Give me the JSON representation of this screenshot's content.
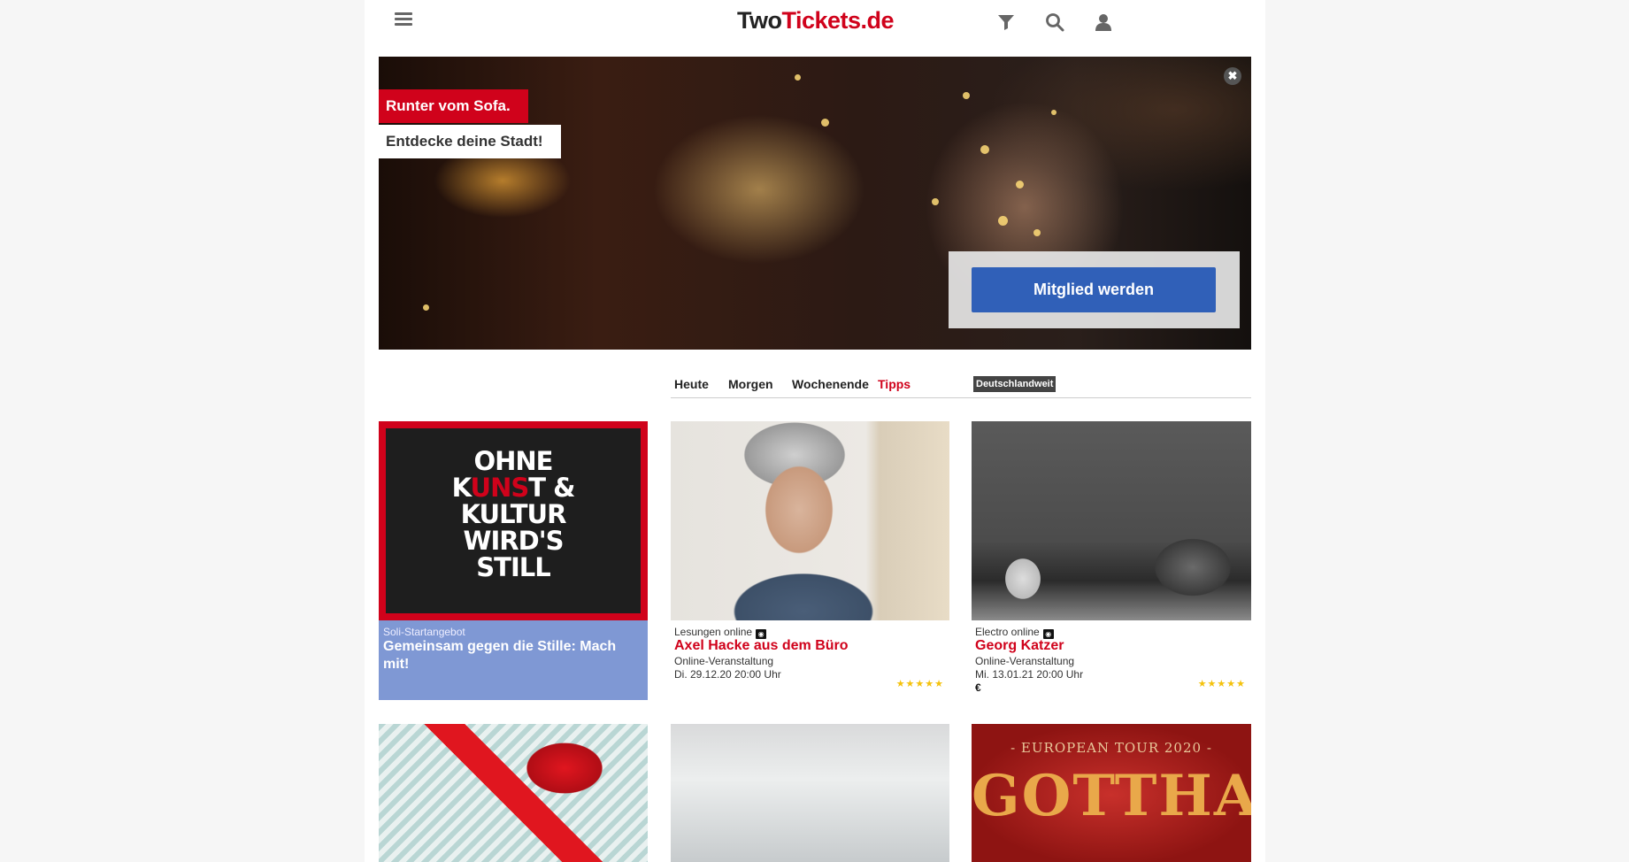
{
  "header": {
    "logo_part1": "Two",
    "logo_part2": "Tickets.de",
    "icons": [
      "menu-icon",
      "filter-icon",
      "search-icon",
      "user-icon"
    ]
  },
  "hero": {
    "headline": "Runter vom Sofa.",
    "subline": "Entdecke deine Stadt!",
    "close_symbol": "✖",
    "cta_label": "Mitglied werden"
  },
  "filters": {
    "tabs": [
      "Heute",
      "Morgen",
      "Wochenende",
      "Tipps"
    ],
    "active_tab": "Tipps",
    "region": "Deutschlandweit"
  },
  "cards": [
    {
      "poster_lines": [
        "OHNE",
        "KUNST &",
        "KULTUR",
        "WIRD'S",
        "STILL"
      ],
      "category": "Soli-Startangebot",
      "title": "Gemeinsam gegen die Stille: Mach mit!"
    },
    {
      "category": "Lesungen online",
      "title": "Axel Hacke aus dem Büro",
      "subtitle": "Online-Veranstaltung",
      "date": "Di. 29.12.20 20:00 Uhr",
      "rating_stars": 5
    },
    {
      "category": "Electro online",
      "title": "Georg Katzer",
      "subtitle": "Online-Veranstaltung",
      "date": "Mi. 13.01.21 20:00 Uhr",
      "price": "€",
      "rating_stars": 5
    }
  ],
  "row2": {
    "gotthard_tour": "- EUROPEAN TOUR 2020 -",
    "gotthard_band": "GOTTHARD"
  },
  "colors": {
    "brand_red": "#d0021b",
    "cta_blue": "#3060b8",
    "soli_bg": "#7f98d4",
    "star": "#f4c20d"
  }
}
